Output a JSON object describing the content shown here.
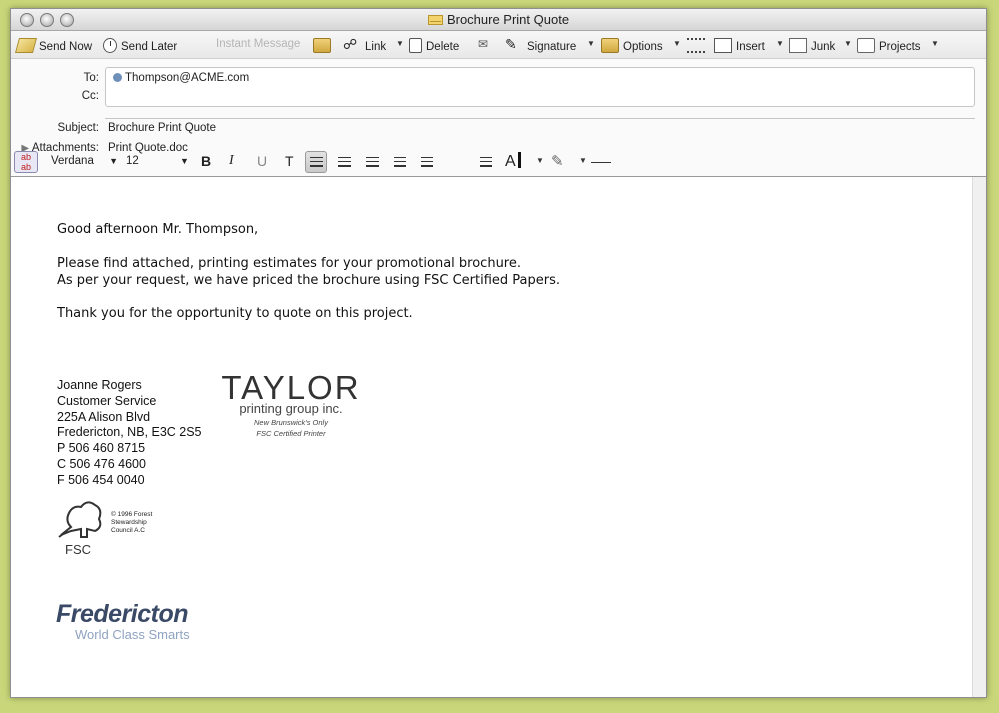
{
  "window": {
    "title": "Brochure Print Quote"
  },
  "toolbar": {
    "send_now": "Send Now",
    "send_later": "Send Later",
    "instant_message": "Instant Message",
    "link": "Link",
    "delete": "Delete",
    "signature": "Signature",
    "options": "Options",
    "insert": "Insert",
    "junk": "Junk",
    "projects": "Projects"
  },
  "header": {
    "to_label": "To:",
    "to_value": "Thompson@ACME.com",
    "cc_label": "Cc:",
    "subject_label": "Subject:",
    "subject_value": "Brochure Print Quote",
    "attachments_label": "Attachments:",
    "attachments_value": "Print Quote.doc"
  },
  "format": {
    "font": "Verdana",
    "size": "12",
    "bold": "B",
    "italic": "I",
    "underline": "U",
    "text_style": "T",
    "color_glyph": "A"
  },
  "message": {
    "greeting": "Good afternoon Mr. Thompson,",
    "line1": "Please find attached, printing estimates for your promotional brochure.",
    "line2": "As per your request, we have priced the brochure using FSC Certified Papers.",
    "line3": "Thank you for the opportunity to quote on this project."
  },
  "signature": {
    "name": "Joanne Rogers",
    "dept": "Customer Service",
    "address1": "225A Alison Blvd",
    "address2": "Fredericton, NB, E3C 2S5",
    "phone": "P 506 460 8715",
    "cell": "C 506 476 4600",
    "fax": "F 506 454 0040"
  },
  "taylor_logo": {
    "name": "TAYLOR",
    "sub": "printing group inc.",
    "tag1": "New Brunswick's Only",
    "tag2": "FSC Certified Printer"
  },
  "fsc_logo": {
    "abbr": "FSC",
    "line1": "© 1996 Forest",
    "line2": "Stewardship",
    "line3": "Council A.C"
  },
  "fredericton_logo": {
    "name": "Fredericton",
    "tagline": "World Class Smarts"
  }
}
